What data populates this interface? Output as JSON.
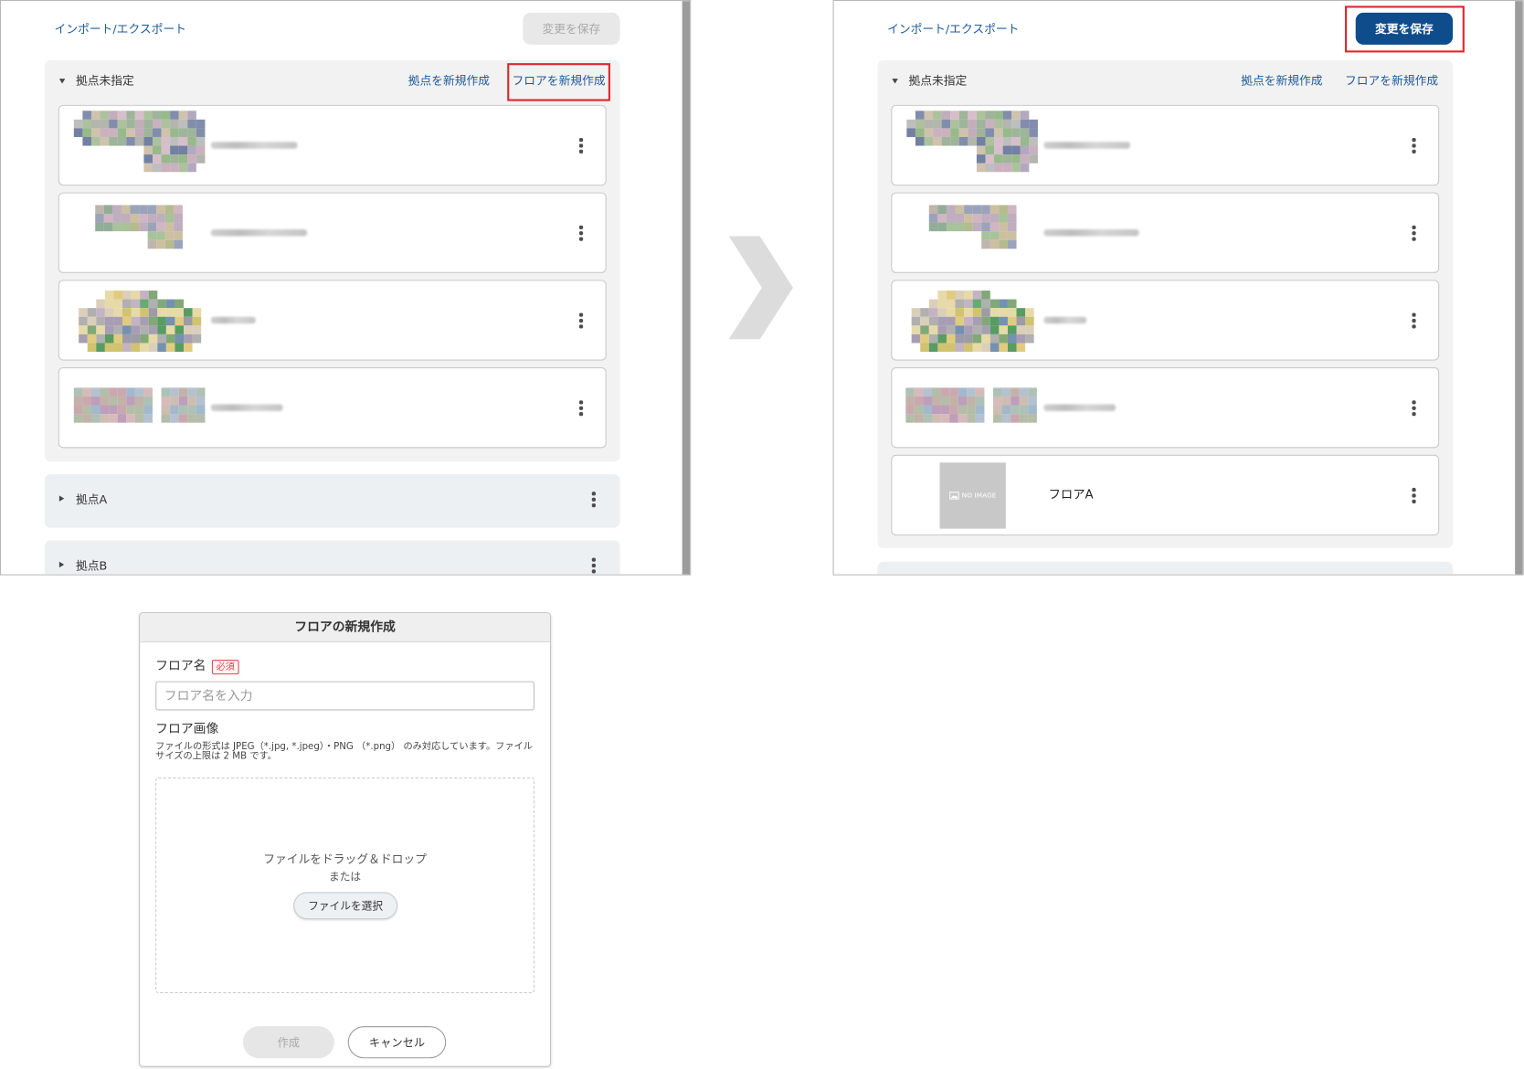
{
  "colors": {
    "link": "#1e5a9c",
    "primary_button": "#0f4c8b",
    "highlight_frame": "#e0262b",
    "required_badge": "#e0454b",
    "group_expanded_bg": "#f2f2f2",
    "group_collapsed_bg": "#edf0f3",
    "arrow": "#dcdcdc"
  },
  "icons": {
    "expand": "caret-down-icon",
    "collapse": "caret-right-icon",
    "menu": "more-vert-icon",
    "transition": "chevron-right-icon",
    "no_image": "image-icon"
  },
  "before": {
    "toolbar": {
      "import_export_link": "インポート/エクスポート",
      "save_button": {
        "label": "変更を保存",
        "enabled": false,
        "highlighted": false
      }
    },
    "unassigned_group": {
      "title": "拠点未指定",
      "expanded": true,
      "new_site_link": {
        "label": "拠点を新規作成",
        "highlighted": false
      },
      "new_floor_link": {
        "label": "フロアを新規作成",
        "highlighted": true
      },
      "floors": [
        {
          "name_obscured": true
        },
        {
          "name_obscured": true
        },
        {
          "name_obscured": true
        },
        {
          "name_obscured": true
        }
      ]
    },
    "sites": [
      {
        "title": "拠点A",
        "expanded": false
      },
      {
        "title": "拠点B",
        "expanded": false
      }
    ]
  },
  "after": {
    "toolbar": {
      "import_export_link": "インポート/エクスポート",
      "save_button": {
        "label": "変更を保存",
        "enabled": true,
        "highlighted": true
      }
    },
    "unassigned_group": {
      "title": "拠点未指定",
      "expanded": true,
      "new_site_link": {
        "label": "拠点を新規作成",
        "highlighted": false
      },
      "new_floor_link": {
        "label": "フロアを新規作成",
        "highlighted": false
      },
      "floors": [
        {
          "name_obscured": true
        },
        {
          "name_obscured": true
        },
        {
          "name_obscured": true
        },
        {
          "name_obscured": true
        },
        {
          "name": "フロアA",
          "thumbnail_placeholder": "NO IMAGE"
        }
      ]
    }
  },
  "dialog": {
    "title": "フロアの新規作成",
    "floor_name": {
      "label": "フロア名",
      "required_badge": "必須",
      "value": "",
      "placeholder": "フロア名を入力"
    },
    "floor_image": {
      "label": "フロア画像",
      "help": "ファイルの形式は JPEG（*.jpg, *.jpeg）・PNG （*.png） のみ対応しています。ファイルサイズの上限は 2 MB です。",
      "dropzone_text": "ファイルをドラッグ＆ドロップ",
      "or_text": "または",
      "select_button": "ファイルを選択"
    },
    "create_button": {
      "label": "作成",
      "enabled": false
    },
    "cancel_button": {
      "label": "キャンセル",
      "enabled": true
    }
  }
}
